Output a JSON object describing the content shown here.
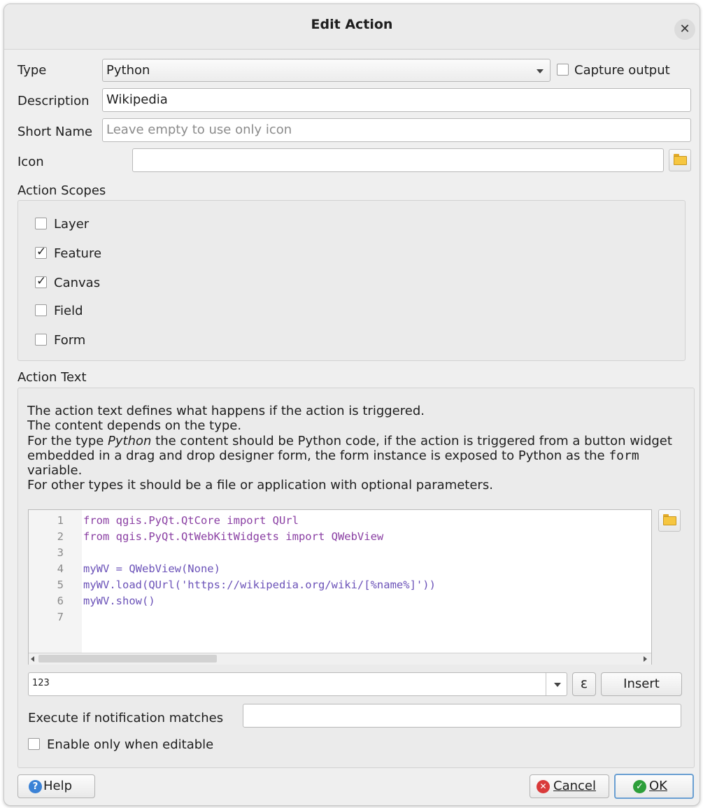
{
  "dialog": {
    "title": "Edit Action"
  },
  "form": {
    "type_label": "Type",
    "type_value": "Python",
    "capture_output_label": "Capture output",
    "capture_output_checked": false,
    "description_label": "Description",
    "description_value": "Wikipedia",
    "short_name_label": "Short Name",
    "short_name_placeholder": "Leave empty to use only icon",
    "icon_label": "Icon",
    "icon_value": ""
  },
  "scopes": {
    "title": "Action Scopes",
    "items": [
      {
        "label": "Layer",
        "checked": false
      },
      {
        "label": "Feature",
        "checked": true
      },
      {
        "label": "Canvas",
        "checked": true
      },
      {
        "label": "Field",
        "checked": false
      },
      {
        "label": "Form",
        "checked": false
      }
    ]
  },
  "action_text": {
    "title": "Action Text",
    "help_line1": "The action text defines what happens if the action is triggered.",
    "help_line2": "The content depends on the type.",
    "help_line3_a": "For the type ",
    "help_line3_em": "Python",
    "help_line3_b": " the content should be Python code, if the action is triggered from a button widget embedded in a drag and drop designer form, the form instance is exposed to Python as the ",
    "help_line3_code": "form",
    "help_line3_c": " variable.",
    "help_line4": "For other types it should be a file or application with optional parameters.",
    "code_lines": [
      "from qgis.PyQt.QtCore import QUrl",
      "from qgis.PyQt.QtWebKitWidgets import QWebView",
      "",
      "myWV = QWebView(None)",
      "myWV.load(QUrl('https://wikipedia.org/wiki/[%name%]'))",
      "myWV.show()",
      ""
    ],
    "line_numbers": [
      "1",
      "2",
      "3",
      "4",
      "5",
      "6",
      "7"
    ],
    "field_combo_value": "123",
    "expression_button": "ε",
    "insert_button": "Insert",
    "notification_label": "Execute if notification matches",
    "notification_value": "",
    "editable_only_label": "Enable only when editable",
    "editable_only_checked": false
  },
  "buttons": {
    "help": "Help",
    "cancel": "Cancel",
    "ok": "OK"
  }
}
